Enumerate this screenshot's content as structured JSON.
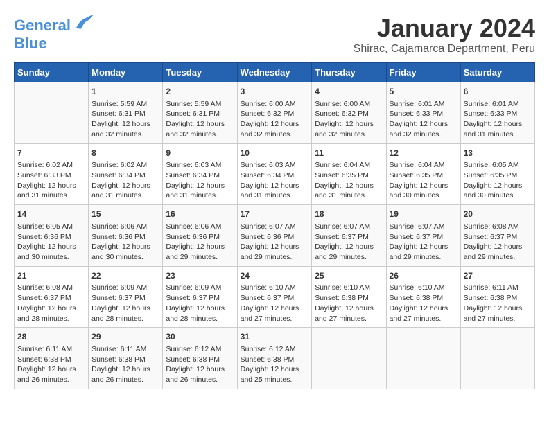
{
  "logo": {
    "line1": "General",
    "line2": "Blue"
  },
  "title": "January 2024",
  "subtitle": "Shirac, Cajamarca Department, Peru",
  "days_header": [
    "Sunday",
    "Monday",
    "Tuesday",
    "Wednesday",
    "Thursday",
    "Friday",
    "Saturday"
  ],
  "weeks": [
    [
      {
        "num": "",
        "info": ""
      },
      {
        "num": "1",
        "info": "Sunrise: 5:59 AM\nSunset: 6:31 PM\nDaylight: 12 hours and 32 minutes."
      },
      {
        "num": "2",
        "info": "Sunrise: 5:59 AM\nSunset: 6:31 PM\nDaylight: 12 hours and 32 minutes."
      },
      {
        "num": "3",
        "info": "Sunrise: 6:00 AM\nSunset: 6:32 PM\nDaylight: 12 hours and 32 minutes."
      },
      {
        "num": "4",
        "info": "Sunrise: 6:00 AM\nSunset: 6:32 PM\nDaylight: 12 hours and 32 minutes."
      },
      {
        "num": "5",
        "info": "Sunrise: 6:01 AM\nSunset: 6:33 PM\nDaylight: 12 hours and 32 minutes."
      },
      {
        "num": "6",
        "info": "Sunrise: 6:01 AM\nSunset: 6:33 PM\nDaylight: 12 hours and 31 minutes."
      }
    ],
    [
      {
        "num": "7",
        "info": "Sunrise: 6:02 AM\nSunset: 6:33 PM\nDaylight: 12 hours and 31 minutes."
      },
      {
        "num": "8",
        "info": "Sunrise: 6:02 AM\nSunset: 6:34 PM\nDaylight: 12 hours and 31 minutes."
      },
      {
        "num": "9",
        "info": "Sunrise: 6:03 AM\nSunset: 6:34 PM\nDaylight: 12 hours and 31 minutes."
      },
      {
        "num": "10",
        "info": "Sunrise: 6:03 AM\nSunset: 6:34 PM\nDaylight: 12 hours and 31 minutes."
      },
      {
        "num": "11",
        "info": "Sunrise: 6:04 AM\nSunset: 6:35 PM\nDaylight: 12 hours and 31 minutes."
      },
      {
        "num": "12",
        "info": "Sunrise: 6:04 AM\nSunset: 6:35 PM\nDaylight: 12 hours and 30 minutes."
      },
      {
        "num": "13",
        "info": "Sunrise: 6:05 AM\nSunset: 6:35 PM\nDaylight: 12 hours and 30 minutes."
      }
    ],
    [
      {
        "num": "14",
        "info": "Sunrise: 6:05 AM\nSunset: 6:36 PM\nDaylight: 12 hours and 30 minutes."
      },
      {
        "num": "15",
        "info": "Sunrise: 6:06 AM\nSunset: 6:36 PM\nDaylight: 12 hours and 30 minutes."
      },
      {
        "num": "16",
        "info": "Sunrise: 6:06 AM\nSunset: 6:36 PM\nDaylight: 12 hours and 29 minutes."
      },
      {
        "num": "17",
        "info": "Sunrise: 6:07 AM\nSunset: 6:36 PM\nDaylight: 12 hours and 29 minutes."
      },
      {
        "num": "18",
        "info": "Sunrise: 6:07 AM\nSunset: 6:37 PM\nDaylight: 12 hours and 29 minutes."
      },
      {
        "num": "19",
        "info": "Sunrise: 6:07 AM\nSunset: 6:37 PM\nDaylight: 12 hours and 29 minutes."
      },
      {
        "num": "20",
        "info": "Sunrise: 6:08 AM\nSunset: 6:37 PM\nDaylight: 12 hours and 29 minutes."
      }
    ],
    [
      {
        "num": "21",
        "info": "Sunrise: 6:08 AM\nSunset: 6:37 PM\nDaylight: 12 hours and 28 minutes."
      },
      {
        "num": "22",
        "info": "Sunrise: 6:09 AM\nSunset: 6:37 PM\nDaylight: 12 hours and 28 minutes."
      },
      {
        "num": "23",
        "info": "Sunrise: 6:09 AM\nSunset: 6:37 PM\nDaylight: 12 hours and 28 minutes."
      },
      {
        "num": "24",
        "info": "Sunrise: 6:10 AM\nSunset: 6:37 PM\nDaylight: 12 hours and 27 minutes."
      },
      {
        "num": "25",
        "info": "Sunrise: 6:10 AM\nSunset: 6:38 PM\nDaylight: 12 hours and 27 minutes."
      },
      {
        "num": "26",
        "info": "Sunrise: 6:10 AM\nSunset: 6:38 PM\nDaylight: 12 hours and 27 minutes."
      },
      {
        "num": "27",
        "info": "Sunrise: 6:11 AM\nSunset: 6:38 PM\nDaylight: 12 hours and 27 minutes."
      }
    ],
    [
      {
        "num": "28",
        "info": "Sunrise: 6:11 AM\nSunset: 6:38 PM\nDaylight: 12 hours and 26 minutes."
      },
      {
        "num": "29",
        "info": "Sunrise: 6:11 AM\nSunset: 6:38 PM\nDaylight: 12 hours and 26 minutes."
      },
      {
        "num": "30",
        "info": "Sunrise: 6:12 AM\nSunset: 6:38 PM\nDaylight: 12 hours and 26 minutes."
      },
      {
        "num": "31",
        "info": "Sunrise: 6:12 AM\nSunset: 6:38 PM\nDaylight: 12 hours and 25 minutes."
      },
      {
        "num": "",
        "info": ""
      },
      {
        "num": "",
        "info": ""
      },
      {
        "num": "",
        "info": ""
      }
    ]
  ]
}
